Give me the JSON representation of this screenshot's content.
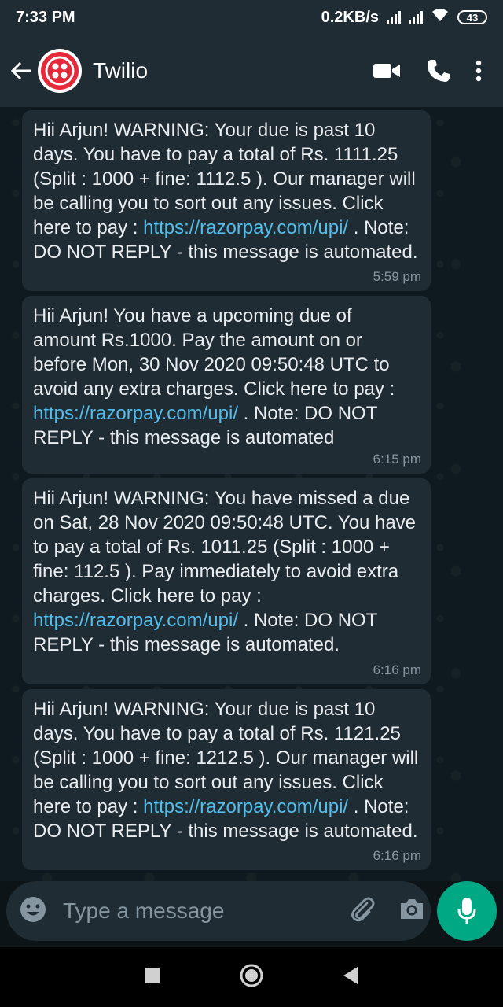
{
  "status_bar": {
    "time": "7:33 PM",
    "network_speed": "0.2KB/s",
    "battery": "43"
  },
  "header": {
    "contact_name": "Twilio"
  },
  "messages": [
    {
      "parts": [
        "Hii Arjun! WARNING: Your due is past 10 days. You have to pay a total of Rs. 1111.25 (Split : 1000 + fine: 1112.5 ). Our manager will be calling you to sort out any issues. Click here to pay : ",
        "https://razorpay.com/upi/",
        " . Note: DO NOT REPLY - this message is automated."
      ],
      "time": "5:59 pm"
    },
    {
      "parts": [
        "Hii Arjun! You have a upcoming due of amount Rs.1000. Pay the amount on or before Mon, 30 Nov 2020 09:50:48 UTC to avoid any extra charges. Click here to pay : ",
        "https://razorpay.com/upi/",
        " . Note: DO NOT REPLY - this message is automated"
      ],
      "time": "6:15 pm"
    },
    {
      "parts": [
        "Hii Arjun! WARNING: You have missed a due on Sat, 28 Nov 2020 09:50:48 UTC. You have to pay a total of Rs. 1011.25 (Split : 1000 + fine: 112.5 ). Pay immediately to avoid extra charges. Click here to pay : ",
        "https://razorpay.com/upi/",
        " . Note: DO NOT REPLY - this message is automated."
      ],
      "time": "6:16 pm"
    },
    {
      "parts": [
        "Hii Arjun! WARNING: Your due is past 10 days. You have to pay a total of Rs. 1121.25 (Split : 1000 + fine: 1212.5 ). Our manager will be calling you to sort out any issues. Click here to pay : ",
        "https://razorpay.com/upi/",
        " . Note: DO NOT REPLY - this message is automated."
      ],
      "time": "6:16 pm"
    }
  ],
  "input": {
    "placeholder": "Type a message"
  },
  "icons": {
    "back": "back-arrow-icon",
    "avatar": "twilio-logo-icon",
    "video": "video-call-icon",
    "call": "phone-icon",
    "menu": "more-vert-icon",
    "emoji": "emoji-icon",
    "attach": "paperclip-icon",
    "camera": "camera-icon",
    "mic": "microphone-icon",
    "wifi": "wifi-icon",
    "signal": "signal-icon",
    "nav_recents": "recents-square-icon",
    "nav_home": "home-circle-icon",
    "nav_back": "back-triangle-icon"
  },
  "colors": {
    "accent": "#00a884",
    "link": "#53bdeb",
    "bubble": "#1f2c34",
    "header": "#1f2c34",
    "twilio_red": "#e52a3b"
  }
}
